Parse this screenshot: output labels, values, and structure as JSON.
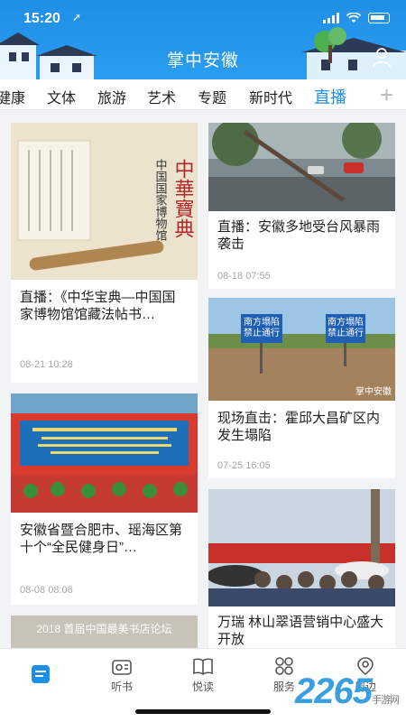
{
  "status": {
    "time": "15:20",
    "location_glyph": "➚"
  },
  "header": {
    "title": "掌中安徽"
  },
  "tabs": [
    {
      "label": "健康"
    },
    {
      "label": "文体"
    },
    {
      "label": "旅游"
    },
    {
      "label": "艺术"
    },
    {
      "label": "专题"
    },
    {
      "label": "新时代"
    },
    {
      "label": "直播",
      "active": true
    }
  ],
  "tabs_add": "+",
  "cards": [
    {
      "title": "直播：《中华宝典—中国国家博物馆馆藏法帖书…",
      "time": "08-21 10:28",
      "image_text": "中華寶典",
      "image_sub": "中国国家博物馆"
    },
    {
      "title": "安徽省暨合肥市、瑶海区第十个“全民健身日”…",
      "time": "08-08 08:06"
    },
    {
      "title": "",
      "time": "",
      "image_text": "2018 首届中国最美书店论坛"
    },
    {
      "title": "直播：安徽多地受台风暴雨袭击",
      "time": "08-18 07:55"
    },
    {
      "title": "现场直击：霍邱大昌矿区内发生塌陷",
      "time": "07-25 16:05",
      "image_text": "南方塌陷 禁止通行",
      "image_text_2": "南方塌陷 禁止通行",
      "image_badge": "掌中安徽"
    },
    {
      "title": "万瑞 林山翠语营销中心盛大开放",
      "time": ""
    }
  ],
  "bottom_nav": [
    {
      "label": "",
      "icon": "home-icon",
      "active": true
    },
    {
      "label": "听书",
      "icon": "radio-icon"
    },
    {
      "label": "悦读",
      "icon": "book-icon"
    },
    {
      "label": "服务",
      "icon": "grid-icon"
    },
    {
      "label": "周边",
      "icon": "location-icon"
    }
  ],
  "watermark": {
    "text": "2265",
    "sub": "手游网"
  },
  "colors": {
    "brand": "#1c8fe8",
    "header": "#2a9df0"
  }
}
